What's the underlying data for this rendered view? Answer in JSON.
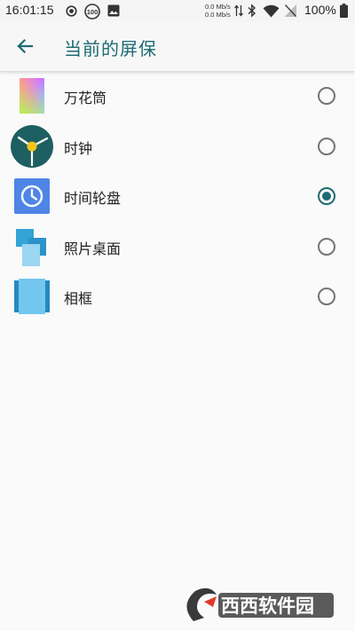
{
  "status_bar": {
    "time": "16:01:15",
    "notification_badge": "100",
    "net_up": "0.0 Mb/s",
    "net_down": "0.0 Mb/s",
    "battery": "100%"
  },
  "app_bar": {
    "title": "当前的屏保"
  },
  "screensavers": [
    {
      "label": "万花筒",
      "icon": "kaleidoscope-icon",
      "selected": false
    },
    {
      "label": "时钟",
      "icon": "clock-icon",
      "selected": false
    },
    {
      "label": "时间轮盘",
      "icon": "clock-wheel-icon",
      "selected": true
    },
    {
      "label": "照片桌面",
      "icon": "photo-table-icon",
      "selected": false
    },
    {
      "label": "相框",
      "icon": "photo-frame-icon",
      "selected": false
    }
  ],
  "watermark": {
    "brand": "西西软件园",
    "site": "CR173.COM"
  },
  "colors": {
    "accent": "#1d6b73",
    "radio_off": "#757575"
  }
}
